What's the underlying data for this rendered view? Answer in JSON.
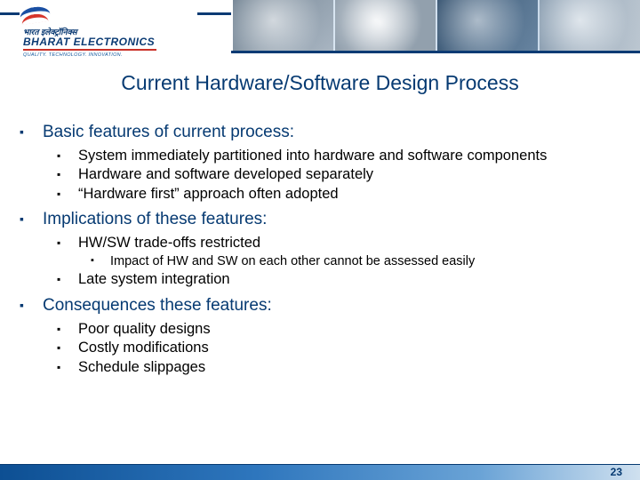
{
  "brand": {
    "hindi": "भारत इलेक्ट्रॉनिक्स",
    "english": "BHARAT ELECTRONICS",
    "tagline": "QUALITY. TECHNOLOGY. INNOVATION."
  },
  "title": "Current Hardware/Software Design Process",
  "sections": [
    {
      "heading": "Basic features of current process:",
      "items": [
        {
          "text": "System immediately partitioned into hardware and software components",
          "justify": true
        },
        {
          "text": " Hardware and software developed separately"
        },
        {
          "text": "“Hardware first” approach often adopted"
        }
      ]
    },
    {
      "heading": "Implications of these features:",
      "items": [
        {
          "text": "HW/SW trade-offs restricted",
          "sub": [
            {
              "text": "Impact of HW and SW on each other cannot be assessed easily"
            }
          ]
        },
        {
          "text": "Late system integration"
        }
      ]
    },
    {
      "heading": "Consequences these features:",
      "items": [
        {
          "text": "Poor quality designs"
        },
        {
          "text": "Costly modifications"
        },
        {
          "text": "Schedule slippages"
        }
      ]
    }
  ],
  "page_number": "23"
}
